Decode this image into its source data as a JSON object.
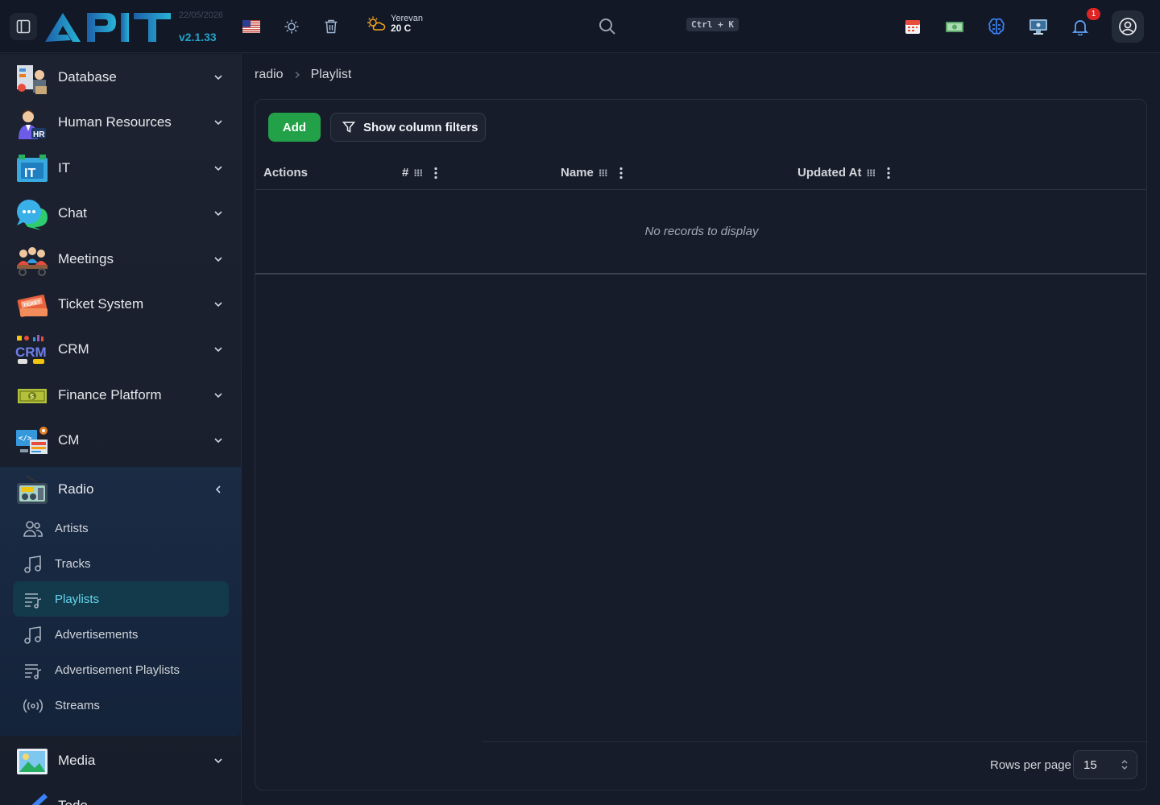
{
  "header": {
    "build_date": "22/05/2026",
    "version": "v2.1.33",
    "weather": {
      "city": "Yerevan",
      "temp": "20 C"
    },
    "search_shortcut": "Ctrl + K",
    "notification_count": "1"
  },
  "sidebar": {
    "items": [
      {
        "label": "Database"
      },
      {
        "label": "Human Resources"
      },
      {
        "label": "IT"
      },
      {
        "label": "Chat"
      },
      {
        "label": "Meetings"
      },
      {
        "label": "Ticket System"
      },
      {
        "label": "CRM"
      },
      {
        "label": "Finance Platform"
      },
      {
        "label": "CM"
      },
      {
        "label": "Radio"
      },
      {
        "label": "Media"
      },
      {
        "label": "Todo"
      }
    ],
    "radio_subitems": [
      {
        "label": "Artists"
      },
      {
        "label": "Tracks"
      },
      {
        "label": "Playlists"
      },
      {
        "label": "Advertisements"
      },
      {
        "label": "Advertisement Playlists"
      },
      {
        "label": "Streams"
      }
    ],
    "active_subitem": "Playlists"
  },
  "breadcrumb": {
    "parent": "radio",
    "current": "Playlist"
  },
  "toolbar": {
    "add_label": "Add",
    "filters_label": "Show column filters"
  },
  "table": {
    "columns": [
      "Actions",
      "#",
      "Name",
      "Updated At"
    ],
    "empty_message": "No records to display"
  },
  "pagination": {
    "rows_per_page_label": "Rows per page",
    "rows_per_page_value": "15"
  },
  "colors": {
    "accent": "#22a3c8",
    "add_button": "#22a148",
    "active_bg": "#123a4a",
    "active_text": "#67d7ef"
  }
}
